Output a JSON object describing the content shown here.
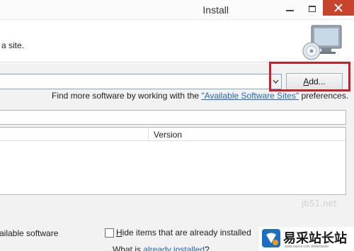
{
  "window": {
    "title": "Install"
  },
  "header": {
    "description": "a site."
  },
  "work_with": {
    "value": "",
    "add_button_label": "Add...",
    "add_button_accel": "A",
    "add_button_rest": "dd..."
  },
  "find_more": {
    "prefix": "Find more software by working with the ",
    "link": "\"Available Software Sites\"",
    "suffix": " preferences."
  },
  "filter": {
    "value": ""
  },
  "table": {
    "columns": [
      "",
      "Version"
    ],
    "rows": []
  },
  "options": {
    "left_label": "ailable software",
    "hide_installed_accel": "H",
    "hide_installed_rest": "ide items that are already installed",
    "hide_installed_checked": false,
    "whatis_prefix": "What is ",
    "whatis_link": "already installed",
    "whatis_suffix": "?"
  },
  "watermark": {
    "domain": "jb51.net",
    "logo_text": "易采站长站",
    "logo_sub": "www.easck.com Webmaster"
  },
  "colors": {
    "close_button": "#c7432b",
    "highlight": "#c8202a",
    "link": "#2266bb"
  }
}
